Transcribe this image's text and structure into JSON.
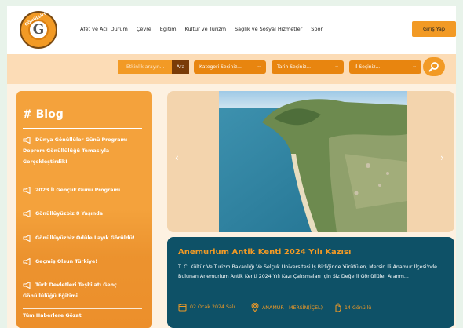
{
  "logo": {
    "letter": "G",
    "ring_text": "GÖNÜLLÜYÜZ BİZ"
  },
  "nav": {
    "items": [
      "Afet ve Acil Durum",
      "Çevre",
      "Eğitim",
      "Kültür ve Turizm",
      "Sağlık ve Sosyal Hizmetler",
      "Spor"
    ],
    "login": "Giriş Yap"
  },
  "search": {
    "placeholder": "Etkinlik arayın...",
    "button": "Ara",
    "category": "Kategori Seçiniz...",
    "date": "Tarih Seçiniz...",
    "city": "İl Seçiniz..."
  },
  "blog": {
    "title": "# Blog",
    "posts": [
      "Dünya Gönüllüler Günü Programı Deprem Gönüllülüğü Temasıyla Gerçekleştirdik!",
      "2023 İl Gençlik Günü Programı",
      "Gönüllüyüzbiz 8 Yaşında",
      "Gönüllüyüzbiz Ödüle Layık Görüldü!",
      "Geçmiş Olsun Türkiye!",
      "Türk Devletleri Teşkilatı Genç Gönüllülüğü Eğitimi"
    ],
    "all_link": "Tüm Haberlere Gözat"
  },
  "slider": {
    "prev": "‹",
    "next": "›"
  },
  "event": {
    "title": "Anemurium Antik Kenti 2024 Yılı Kazısı",
    "description": "T. C. Kültür Ve Turizm Bakanlığı Ve Selçuk Üniversitesi İş Birliğinde Yürütülen, Mersin İli Anamur İlçesi'nde Bulunan Anemurium Antik Kenti 2024 Yılı Kazı Çalışmaları İçin Siz Değerli Gönüllüler Aranm...",
    "date": "02 Ocak 2024 Salı",
    "location": "ANAMUR - MERSİN(İÇEL)",
    "volunteers": "14 Gönüllü"
  },
  "colors": {
    "orange": "#f29a25",
    "dark_blue": "#0e5167",
    "cream": "#fdf1e1",
    "brown": "#7a3c08"
  }
}
